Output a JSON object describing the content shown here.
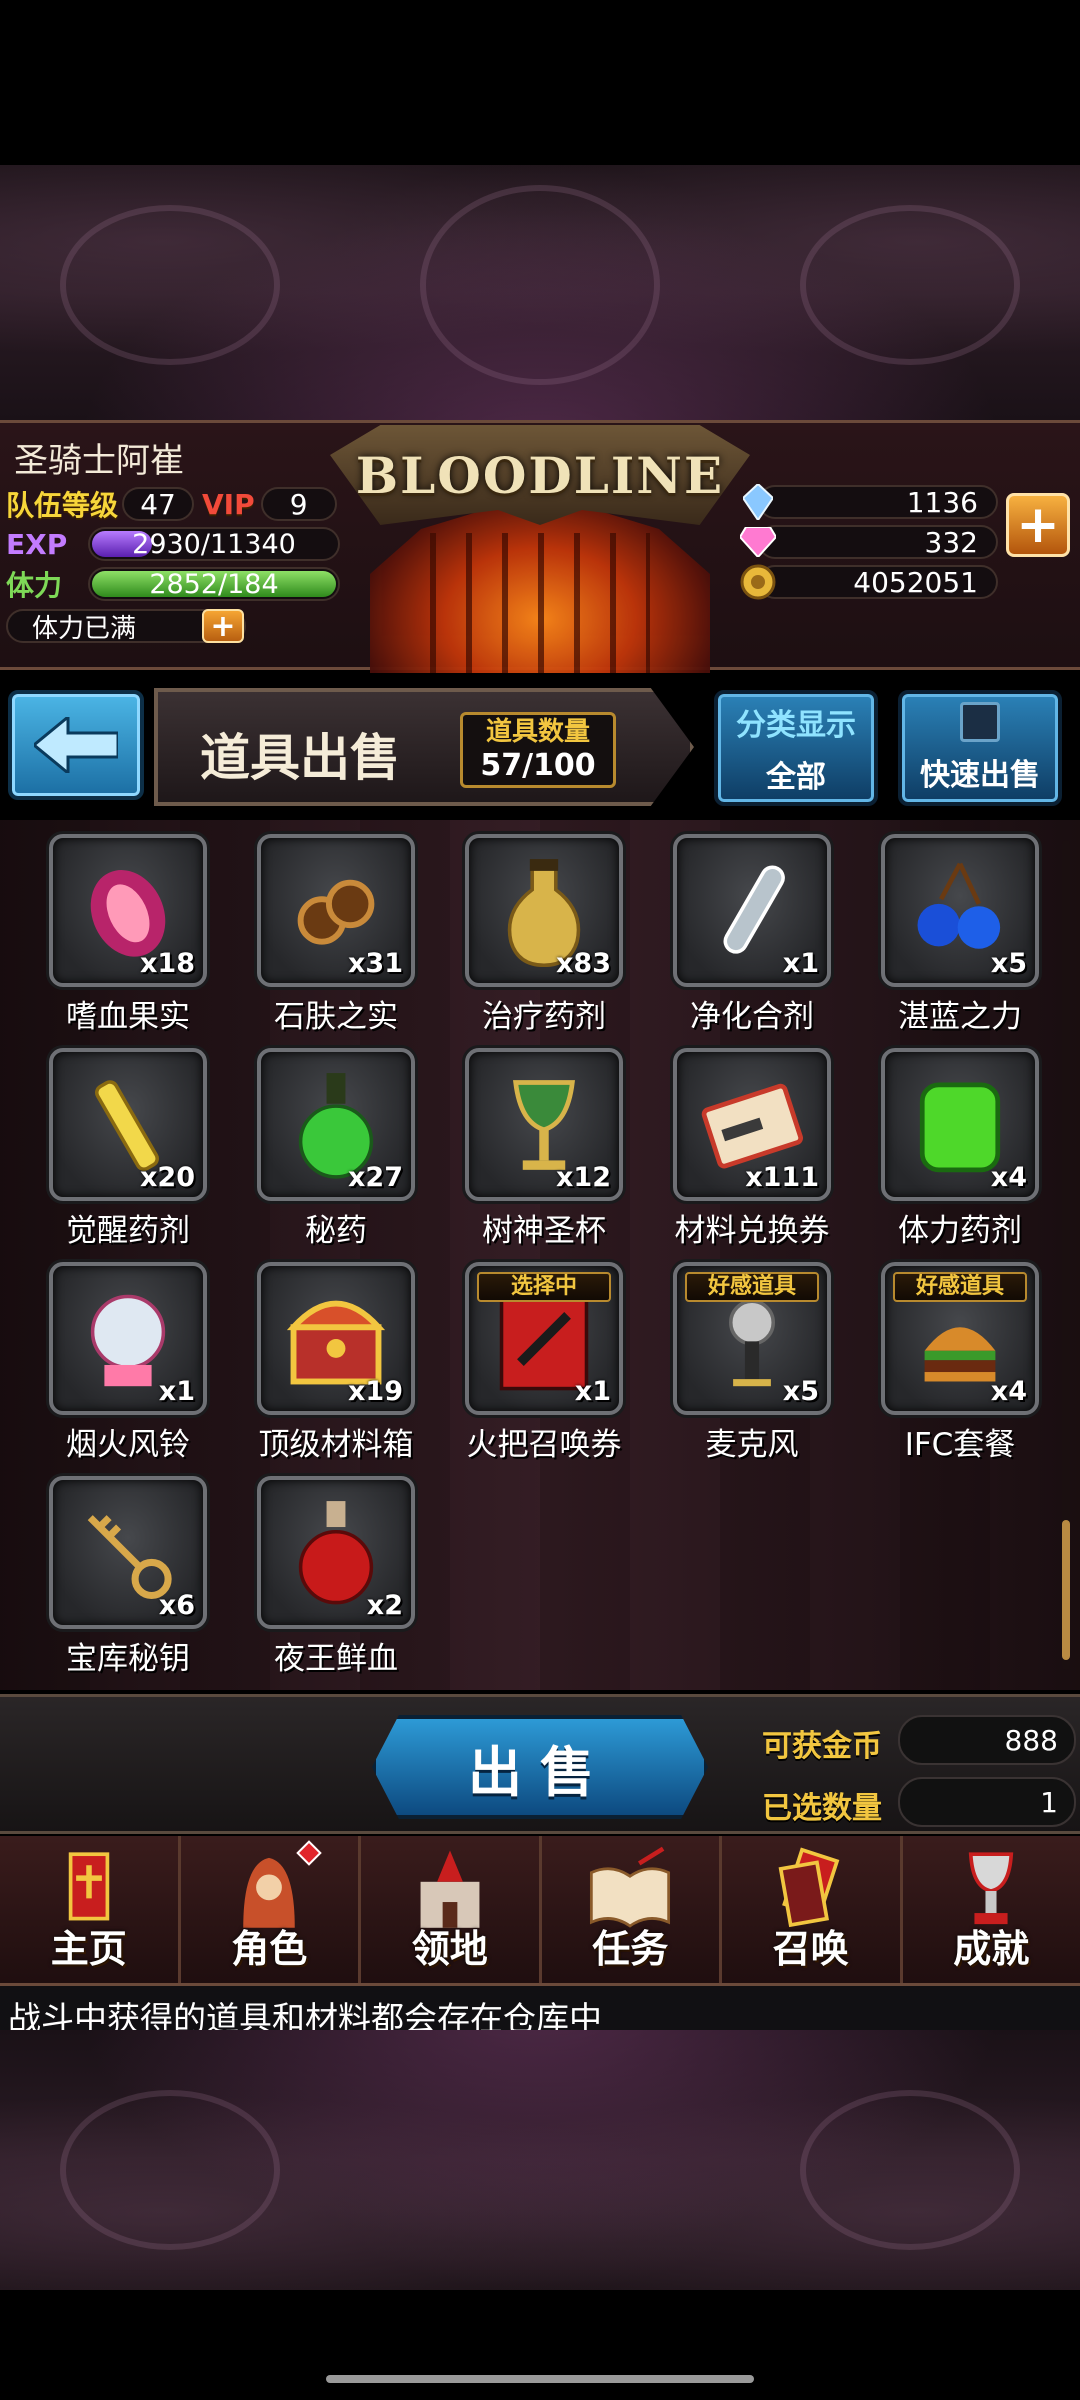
{
  "game": {
    "logo_text": "BLOODLINE"
  },
  "player": {
    "name": "圣骑士阿崔",
    "team_level_label": "队伍等级",
    "team_level": "47",
    "vip_label": "VIP",
    "vip_level": "9",
    "exp_label": "EXP",
    "exp_text": "2930/11340",
    "exp_fraction": 0.258,
    "stamina_label": "体力",
    "stamina_text": "2852/184",
    "stamina_fraction": 1.0,
    "stamina_status": "体力已满"
  },
  "currencies": [
    {
      "icon": "crystal-icon",
      "value": "1136",
      "color": "#8ac8ff"
    },
    {
      "icon": "gem-icon",
      "value": "332",
      "color": "#ff7ad1"
    },
    {
      "icon": "gold-coin-icon",
      "value": "4052051",
      "color": "#e8b83a"
    }
  ],
  "header": {
    "title": "道具出售",
    "count_label": "道具数量",
    "count_value": "57/100",
    "category_label": "分类显示",
    "category_value": "全部",
    "quick_sell_label": "快速出售"
  },
  "items": [
    {
      "name": "嗜血果实",
      "qty": "x18",
      "icon": "blood-fruit-icon",
      "badge": ""
    },
    {
      "name": "石肤之实",
      "qty": "x31",
      "icon": "stone-skin-fruit-icon",
      "badge": ""
    },
    {
      "name": "治疗药剂",
      "qty": "x83",
      "icon": "healing-potion-icon",
      "badge": ""
    },
    {
      "name": "净化合剂",
      "qty": "x1",
      "icon": "test-tube-icon",
      "badge": ""
    },
    {
      "name": "湛蓝之力",
      "qty": "x5",
      "icon": "blue-berries-icon",
      "badge": ""
    },
    {
      "name": "觉醒药剂",
      "qty": "x20",
      "icon": "awakening-vial-icon",
      "badge": ""
    },
    {
      "name": "秘药",
      "qty": "x27",
      "icon": "green-flask-icon",
      "badge": ""
    },
    {
      "name": "树神圣杯",
      "qty": "x12",
      "icon": "chalice-icon",
      "badge": ""
    },
    {
      "name": "材料兑换券",
      "qty": "x111",
      "icon": "ticket-icon",
      "badge": ""
    },
    {
      "name": "体力药剂",
      "qty": "x4",
      "icon": "stamina-potion-icon",
      "badge": ""
    },
    {
      "name": "烟火风铃",
      "qty": "x1",
      "icon": "wind-chime-icon",
      "badge": ""
    },
    {
      "name": "顶级材料箱",
      "qty": "x19",
      "icon": "treasure-chest-icon",
      "badge": ""
    },
    {
      "name": "火把召唤券",
      "qty": "x1",
      "icon": "summon-ticket-icon",
      "badge": "选择中"
    },
    {
      "name": "麦克风",
      "qty": "x5",
      "icon": "microphone-icon",
      "badge": "好感道具"
    },
    {
      "name": "IFC套餐",
      "qty": "x4",
      "icon": "burger-meal-icon",
      "badge": "好感道具"
    },
    {
      "name": "宝库秘钥",
      "qty": "x6",
      "icon": "key-icon",
      "badge": ""
    },
    {
      "name": "夜王鲜血",
      "qty": "x2",
      "icon": "blood-flask-icon",
      "badge": ""
    }
  ],
  "sell": {
    "button_label": "出售",
    "gold_label": "可获金币",
    "gold_value": "888",
    "selected_label": "已选数量",
    "selected_value": "1"
  },
  "nav": [
    {
      "label": "主页",
      "icon": "home-banner-icon",
      "notify": false
    },
    {
      "label": "角色",
      "icon": "hooded-character-icon",
      "notify": true
    },
    {
      "label": "领地",
      "icon": "castle-icon",
      "notify": false
    },
    {
      "label": "任务",
      "icon": "quest-book-icon",
      "notify": false
    },
    {
      "label": "召唤",
      "icon": "summon-cards-icon",
      "notify": false
    },
    {
      "label": "成就",
      "icon": "trophy-icon",
      "notify": false
    }
  ],
  "tip": "战斗中获得的道具和材料都会存在仓库中"
}
